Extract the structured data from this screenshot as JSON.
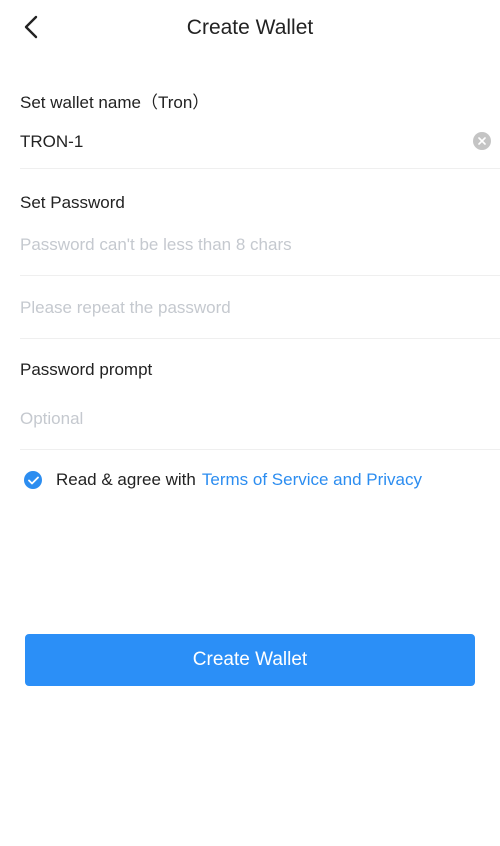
{
  "header": {
    "title": "Create Wallet",
    "back_icon": "chevron-left-icon"
  },
  "wallet_name": {
    "label": "Set wallet name（Tron）",
    "value": "TRON-1",
    "clear_icon": "clear-icon"
  },
  "password": {
    "label": "Set Password",
    "placeholder": "Password can't be less than 8 chars",
    "repeat_placeholder": "Please repeat the password"
  },
  "prompt": {
    "label": "Password prompt",
    "placeholder": "Optional"
  },
  "agreement": {
    "checked": true,
    "text": "Read & agree with",
    "link_text": "Terms of Service and Privacy"
  },
  "cta": {
    "label": "Create Wallet"
  },
  "colors": {
    "accent": "#2b8ff7",
    "link": "#2c8df0",
    "placeholder": "#c5c9cf",
    "divider": "#efefef"
  }
}
